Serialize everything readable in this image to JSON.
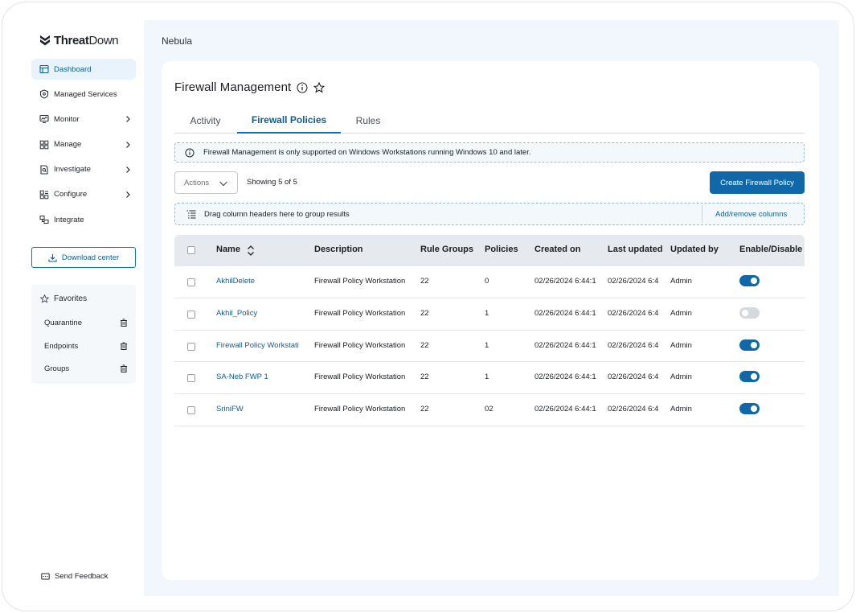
{
  "brand": {
    "name_bold": "Threat",
    "name_regular": "Down"
  },
  "sidebar": {
    "items": [
      {
        "label": "Dashboard",
        "icon": "dashboard-icon",
        "active": true,
        "has_chevron": false
      },
      {
        "label": "Managed Services",
        "icon": "shield-icon",
        "active": false,
        "has_chevron": false
      },
      {
        "label": "Monitor",
        "icon": "monitor-icon",
        "active": false,
        "has_chevron": true
      },
      {
        "label": "Manage",
        "icon": "grid-icon",
        "active": false,
        "has_chevron": true
      },
      {
        "label": "Investigate",
        "icon": "document-search-icon",
        "active": false,
        "has_chevron": true
      },
      {
        "label": "Configure",
        "icon": "configure-icon",
        "active": false,
        "has_chevron": true
      },
      {
        "label": "Integrate",
        "icon": "integrate-icon",
        "active": false,
        "has_chevron": false
      }
    ],
    "download_label": "Download center",
    "favorites": {
      "title": "Favorites",
      "items": [
        "Quarantine",
        "Endpoints",
        "Groups"
      ]
    },
    "feedback_label": "Send Feedback"
  },
  "breadcrumb": "Nebula",
  "page": {
    "title": "Firewall Management",
    "tabs": [
      {
        "label": "Activity",
        "active": false
      },
      {
        "label": "Firewall Policies",
        "active": true
      },
      {
        "label": "Rules",
        "active": false
      }
    ],
    "banner_text": "Firewall Management is only supported on Windows Workstations running Windows 10 and later.",
    "actions_placeholder": "Actions",
    "showing_text": "Showing 5 of 5",
    "create_button": "Create Firewall Policy",
    "group_hint": "Drag column headers here to group results",
    "add_remove_columns": "Add/remove columns"
  },
  "table": {
    "columns": [
      "Name",
      "Description",
      "Rule Groups",
      "Policies",
      "Created on",
      "Last updated",
      "Updated by",
      "Enable/Disable"
    ],
    "rows": [
      {
        "name": "AkhilDelete",
        "description": "Firewall Policy Workstation",
        "rule_groups": "22",
        "policies": "0",
        "created_on": "02/26/2024 6:44:1",
        "last_updated": "02/26/2024 6:4",
        "updated_by": "Admin",
        "enabled": true
      },
      {
        "name": "Akhil_Policy",
        "description": "Firewall Policy Workstation",
        "rule_groups": "22",
        "policies": "1",
        "created_on": "02/26/2024 6:44:1",
        "last_updated": "02/26/2024 6:4",
        "updated_by": "Admin",
        "enabled": false
      },
      {
        "name": "Firewall Policy Workstati",
        "description": "Firewall Policy Workstation",
        "rule_groups": "22",
        "policies": "1",
        "created_on": "02/26/2024 6:44:1",
        "last_updated": "02/26/2024 6:4",
        "updated_by": "Admin",
        "enabled": true
      },
      {
        "name": "SA-Neb FWP 1",
        "description": "Firewall Policy Workstation",
        "rule_groups": "22",
        "policies": "1",
        "created_on": "02/26/2024 6:44:1",
        "last_updated": "02/26/2024 6:4",
        "updated_by": "Admin",
        "enabled": true
      },
      {
        "name": "SriniFW",
        "description": "Firewall Policy Workstation",
        "rule_groups": "22",
        "policies": "02",
        "created_on": "02/26/2024 6:44:1",
        "last_updated": "02/26/2024 6:4",
        "updated_by": "Admin",
        "enabled": true
      }
    ]
  },
  "colors": {
    "accent": "#1168a8",
    "link": "#0f5e91",
    "active_nav_bg": "#e8f3fb",
    "main_bg": "#f1f7fc"
  }
}
